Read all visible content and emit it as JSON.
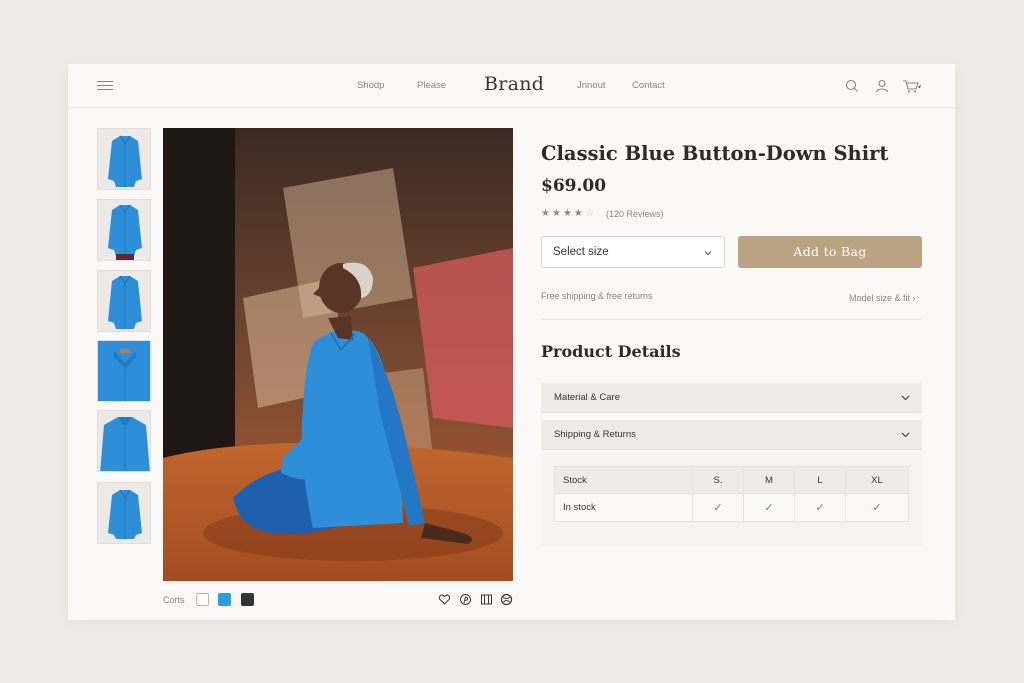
{
  "header": {
    "brand": "Brand",
    "nav_left": [
      "Shodp",
      "Please"
    ],
    "nav_right": [
      "Jnnout",
      "Contact"
    ],
    "icons": [
      "menu-icon",
      "search-icon",
      "user-icon",
      "cart-icon"
    ]
  },
  "gallery": {
    "thumbnail_count": 6,
    "colors_label": "Corts",
    "swatches": [
      "#ffffff",
      "#2e9be4",
      "#333333"
    ],
    "action_icons": [
      "heart-icon",
      "pinterest-icon",
      "share-icon",
      "globe-icon"
    ]
  },
  "product": {
    "title": "Classic Blue Button-Down Shirt",
    "price": "$69.00",
    "rating": {
      "value": 3.5,
      "max": 5
    },
    "reviews": "(120 Reviews)",
    "size_select": "Select size",
    "add_to_bag": "Add to Bag",
    "shipping_note": "Free shipping & free returns",
    "model_link": "Model size & fit"
  },
  "details": {
    "title": "Product Details",
    "accordions": [
      "Material & Care",
      "Shipping & Returns"
    ],
    "stock_table": {
      "headers": [
        "Stock",
        "S.",
        "M",
        "L",
        "XL"
      ],
      "rows": [
        [
          "In stock",
          "✓",
          "✓",
          "✓",
          "✓"
        ]
      ]
    }
  },
  "colors": {
    "accent": "#bba283",
    "check": "#3e9a6e",
    "shirt": "#2e8fd8"
  }
}
